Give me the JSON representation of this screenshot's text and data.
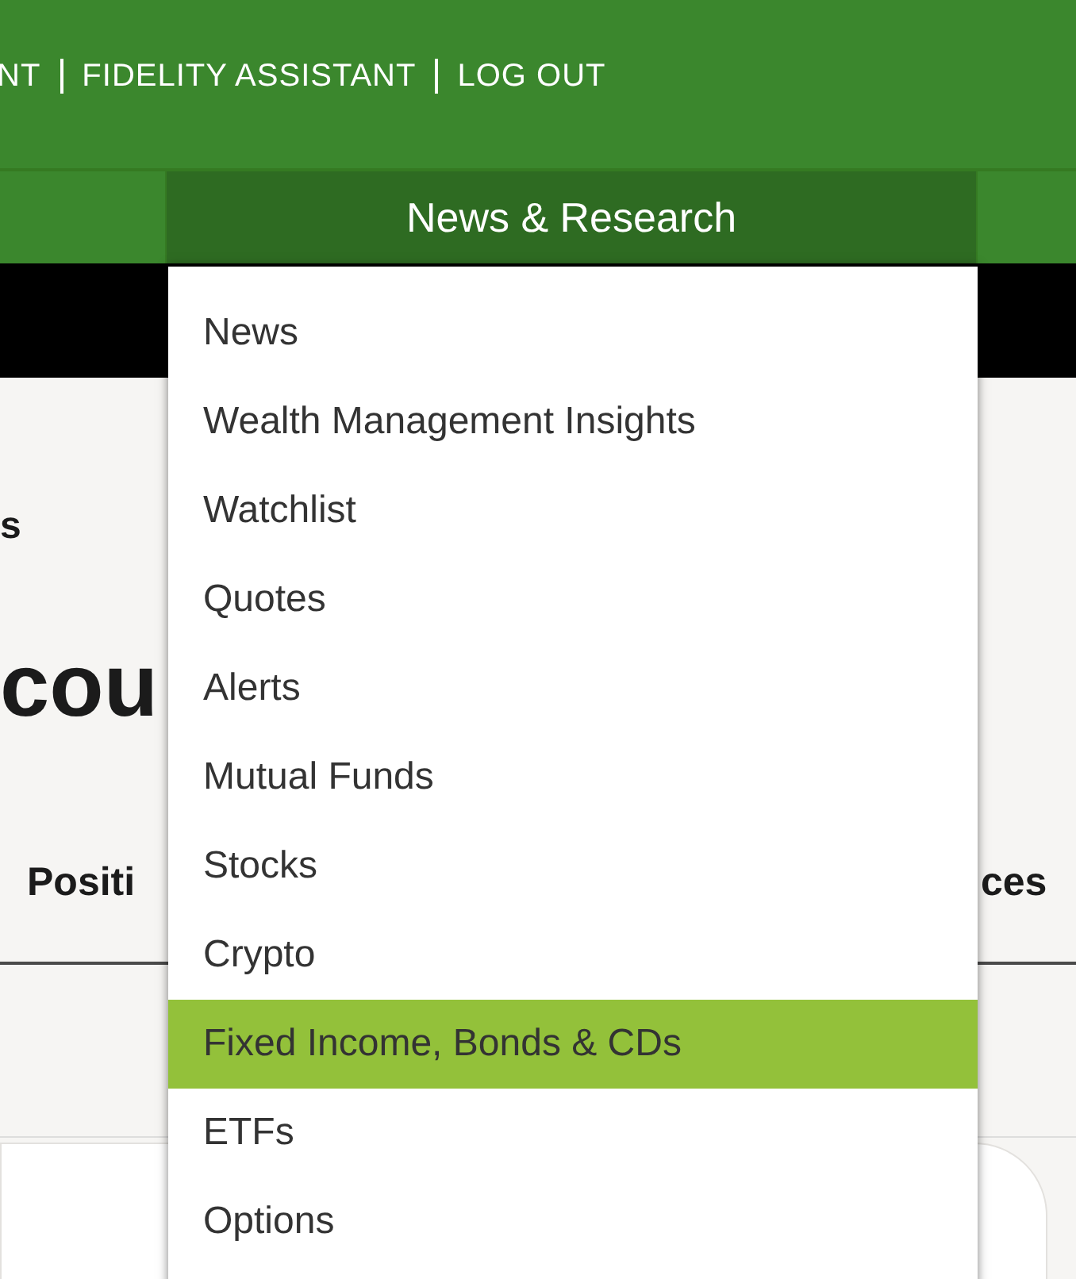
{
  "top_links": [
    "NT",
    "FIDELITY ASSISTANT",
    "LOG OUT"
  ],
  "nav": {
    "tabs": [
      {
        "label": "News & Research",
        "selected": true
      }
    ]
  },
  "page": {
    "breadcrumb": "s",
    "heading": "cou",
    "tabs": [
      {
        "label": "Positi"
      },
      {
        "label": "ces"
      }
    ]
  },
  "dropdown": {
    "items": [
      {
        "label": "News",
        "selected": false
      },
      {
        "label": "Wealth Management Insights",
        "selected": false
      },
      {
        "label": "Watchlist",
        "selected": false
      },
      {
        "label": "Quotes",
        "selected": false
      },
      {
        "label": "Alerts",
        "selected": false
      },
      {
        "label": "Mutual Funds",
        "selected": false
      },
      {
        "label": "Stocks",
        "selected": false
      },
      {
        "label": "Crypto",
        "selected": false
      },
      {
        "label": "Fixed Income, Bonds & CDs",
        "selected": true
      },
      {
        "label": "ETFs",
        "selected": false
      },
      {
        "label": "Options",
        "selected": false
      }
    ]
  }
}
